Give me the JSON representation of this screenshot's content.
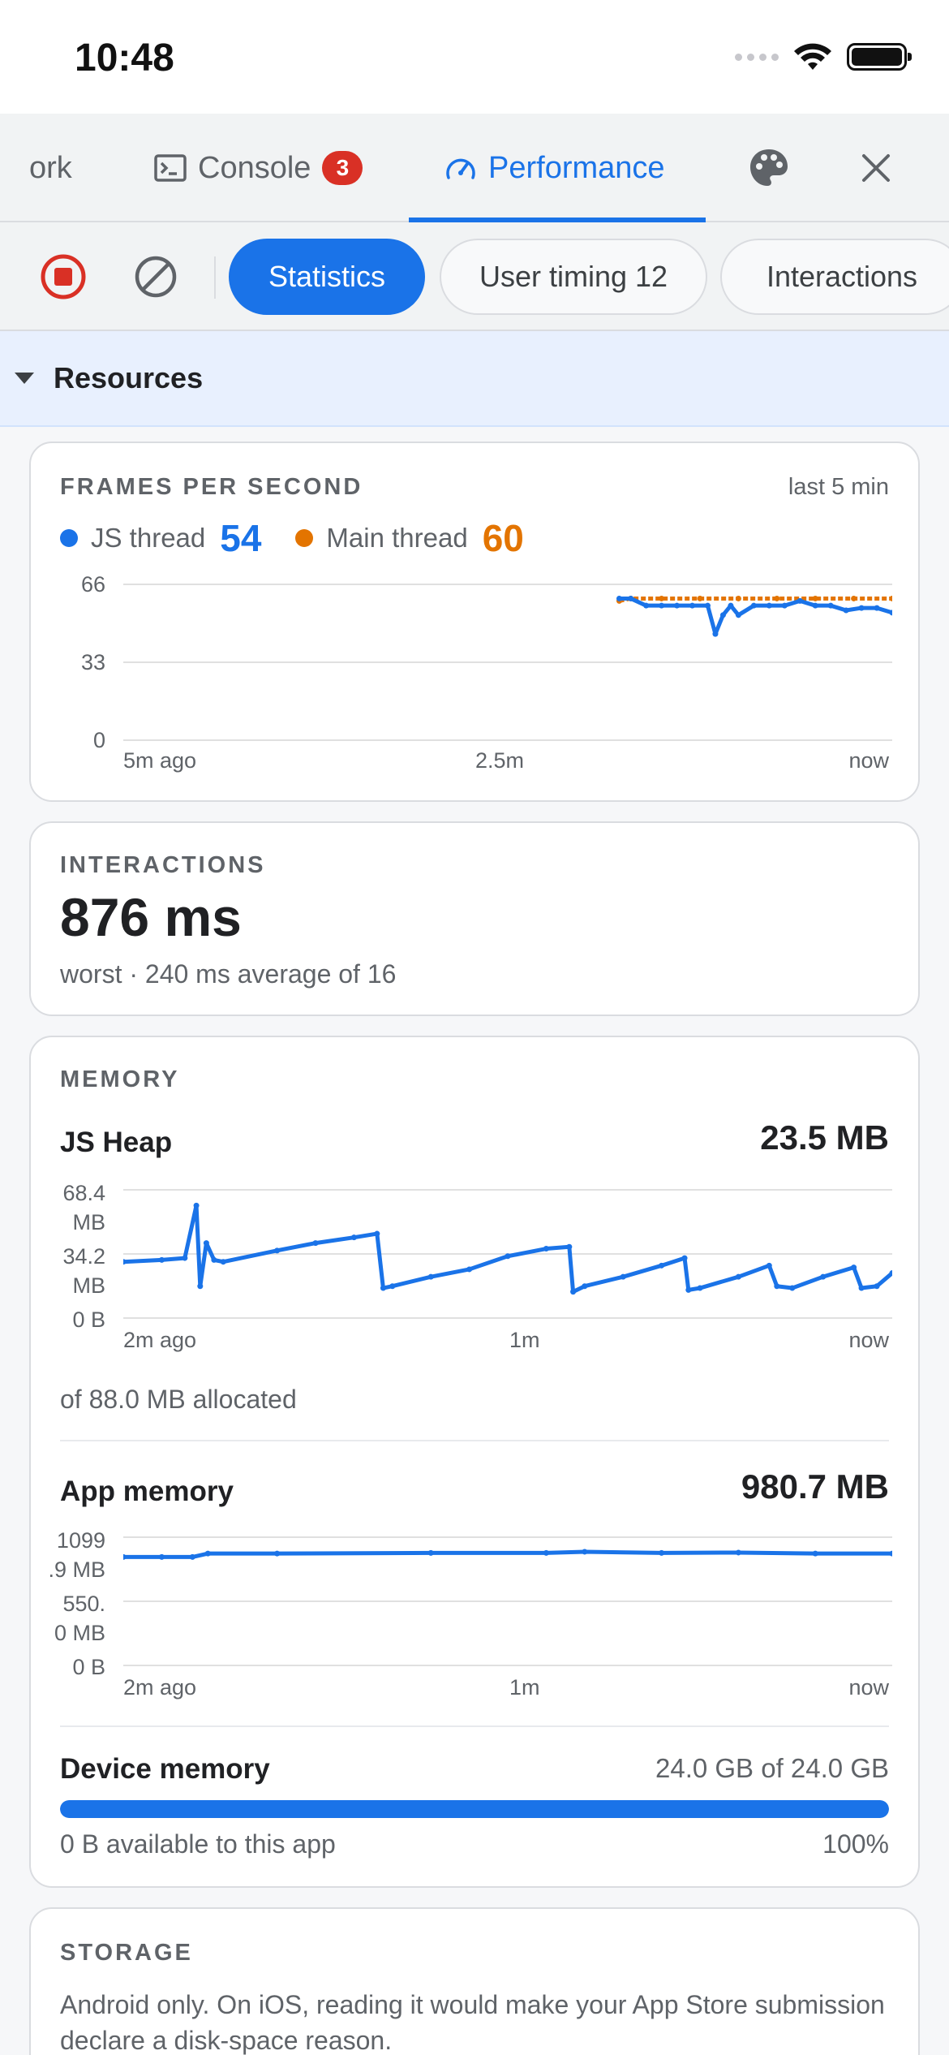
{
  "status_bar": {
    "time": "10:48"
  },
  "tabs": {
    "items": [
      {
        "label": "ork"
      },
      {
        "label": "Console",
        "badge": "3"
      },
      {
        "label": "Performance"
      }
    ]
  },
  "toolbar": {
    "chips": [
      "Statistics",
      "User timing 12",
      "Interactions"
    ]
  },
  "section": {
    "title": "Resources"
  },
  "fps": {
    "label": "FRAMES PER SECOND",
    "range": "last 5 min",
    "js_label": "JS thread",
    "js_value": "54",
    "main_label": "Main thread",
    "main_value": "60",
    "y_ticks": [
      "66",
      "33",
      "0"
    ],
    "x_ticks": [
      "5m ago",
      "2.5m",
      "now"
    ],
    "colors": {
      "js": "#1a73e8",
      "main": "#e37400"
    }
  },
  "interactions": {
    "label": "INTERACTIONS",
    "value": "876 ms",
    "detail": "worst · 240 ms average of 16"
  },
  "memory": {
    "label": "MEMORY",
    "js_heap": {
      "title": "JS Heap",
      "value": "23.5 MB",
      "y_ticks": [
        "68.4\nMB",
        "34.2\nMB",
        "0 B"
      ],
      "x_ticks": [
        "2m ago",
        "1m",
        "now"
      ],
      "allocated": "of 88.0 MB allocated"
    },
    "app_memory": {
      "title": "App memory",
      "value": "980.7 MB",
      "y_ticks": [
        "1099\n.9 MB",
        "550.\n0 MB",
        "0 B"
      ],
      "x_ticks": [
        "2m ago",
        "1m",
        "now"
      ]
    },
    "device_memory": {
      "title": "Device memory",
      "value": "24.0 GB of 24.0 GB",
      "available": "0 B available to this app",
      "percent": "100%",
      "fraction": 1.0
    }
  },
  "storage": {
    "label": "STORAGE",
    "text": "Android only. On iOS, reading it would make your App Store submission declare a disk-space reason."
  },
  "chart_data": [
    {
      "type": "line",
      "title": "FRAMES PER SECOND",
      "ylim": [
        0,
        66
      ],
      "series": [
        {
          "name": "JS thread",
          "x": [
            0.645,
            0.66,
            0.68,
            0.7,
            0.72,
            0.74,
            0.76,
            0.77,
            0.78,
            0.79,
            0.8,
            0.82,
            0.84,
            0.86,
            0.88,
            0.9,
            0.92,
            0.94,
            0.96,
            0.98,
            1.0
          ],
          "values": [
            60,
            60,
            57,
            57,
            57,
            57,
            57,
            45,
            53,
            57,
            53,
            57,
            57,
            57,
            59,
            57,
            57,
            55,
            56,
            56,
            54
          ]
        },
        {
          "name": "Main thread",
          "x": [
            0.645,
            0.66,
            0.7,
            0.75,
            0.8,
            0.85,
            0.9,
            0.95,
            1.0
          ],
          "values": [
            59,
            60,
            60,
            60,
            60,
            60,
            60,
            60,
            60
          ]
        }
      ]
    },
    {
      "type": "line",
      "title": "JS Heap",
      "ylim": [
        0,
        68.4
      ],
      "series": [
        {
          "name": "JS Heap",
          "x": [
            0.0,
            0.05,
            0.08,
            0.095,
            0.1,
            0.108,
            0.118,
            0.13,
            0.2,
            0.25,
            0.3,
            0.33,
            0.338,
            0.35,
            0.4,
            0.45,
            0.5,
            0.55,
            0.58,
            0.585,
            0.6,
            0.65,
            0.7,
            0.73,
            0.735,
            0.75,
            0.8,
            0.84,
            0.85,
            0.87,
            0.91,
            0.95,
            0.96,
            0.98,
            1.0
          ],
          "values": [
            30,
            31,
            32,
            60,
            17,
            40,
            31,
            30,
            36,
            40,
            43,
            45,
            16,
            17,
            22,
            26,
            33,
            37,
            38,
            14,
            17,
            22,
            28,
            32,
            15,
            16,
            22,
            28,
            17,
            16,
            22,
            27,
            16,
            17,
            24
          ]
        }
      ]
    },
    {
      "type": "line",
      "title": "App memory",
      "ylim": [
        0,
        1099.9
      ],
      "series": [
        {
          "name": "App memory",
          "x": [
            0.0,
            0.05,
            0.09,
            0.11,
            0.2,
            0.4,
            0.55,
            0.6,
            0.7,
            0.8,
            0.9,
            1.0
          ],
          "values": [
            930,
            930,
            930,
            960,
            960,
            965,
            965,
            975,
            965,
            968,
            960,
            960
          ]
        }
      ]
    }
  ]
}
